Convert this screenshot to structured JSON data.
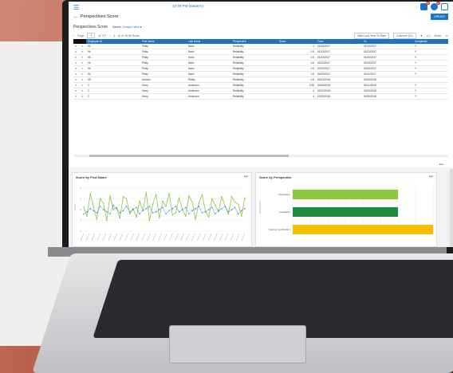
{
  "app": {
    "time": "12:48 PM (Eastern)",
    "notification_count": "99",
    "message_count": "10"
  },
  "page": {
    "title": "Perspectives Score",
    "create_label": "CREATE"
  },
  "view": {
    "title": "Perspectives Score",
    "saved_label": "Saved:",
    "saved_value": "Christy's View"
  },
  "pager": {
    "page_label": "Page",
    "page_value": "1",
    "of_label": "of 727",
    "rows_info": "1 - 15 of 10.9k Rows",
    "filter_chip": "Start Last Year To Date",
    "column_chip": "Columns (11)",
    "filter_count": "(1)",
    "mode_label": "Mode"
  },
  "table": {
    "columns": [
      "",
      "",
      "Employee ID",
      "First Name",
      "Last Name",
      "Perspective",
      "Score",
      "From",
      "To",
      "Completed"
    ],
    "rows": [
      [
        "",
        "",
        "94",
        "Philip",
        "Nash",
        "Reliability",
        "1",
        "01/08/2017",
        "01/15/2017",
        "Y"
      ],
      [
        "",
        "",
        "94",
        "Philip",
        "Nash",
        "Reliability",
        "0.5",
        "01/13/2017",
        "01/21/2017",
        "Y"
      ],
      [
        "",
        "",
        "94",
        "Philip",
        "Nash",
        "Reliability",
        "0.5",
        "01/23/2017",
        "01/30/2017",
        "Y"
      ],
      [
        "",
        "",
        "94",
        "Philip",
        "Nash",
        "Reliability",
        "0.5",
        "02/12/2017",
        "02/19/2017",
        "Y"
      ],
      [
        "",
        "",
        "94",
        "Philip",
        "Nash",
        "Reliability",
        "0.5",
        "02/20/2017",
        "02/04/2017",
        "Y"
      ],
      [
        "",
        "",
        "94",
        "Philip",
        "Nash",
        "Reliability",
        "0.5",
        "04/09/2017",
        "04/11/2017",
        "Y"
      ],
      [
        "",
        "",
        "39",
        "Ammon",
        "Ridley",
        "Reliability",
        "0.5",
        "04/23/2018",
        "04/30/2018",
        ""
      ],
      [
        "",
        "",
        "2",
        "Harry",
        "Anderson",
        "Reliability",
        "3.95",
        "03/25/2018",
        "03/11/2018",
        "Y"
      ],
      [
        "",
        "",
        "2",
        "Harry",
        "Anderson",
        "Reliability",
        "4",
        "03/12/2018",
        "03/20/2018",
        "Y"
      ],
      [
        "",
        "",
        "2",
        "Harry",
        "Anderson",
        "Reliability",
        "4",
        "03/25/2018",
        "04/30/2018",
        "Y"
      ]
    ]
  },
  "charts": {
    "left_title": "Score by First Name",
    "right_title": "Score by Perspective",
    "right_ylabel": "Perspective"
  },
  "chart_data": [
    {
      "type": "line",
      "title": "Score by First Name",
      "ylabel": "Score",
      "ylim": [
        0,
        4
      ],
      "series": [
        {
          "values": [
            2.2,
            1.4,
            3.5,
            2.2,
            1.1,
            3.0,
            2.6,
            1.0,
            3.3,
            2.0,
            2.2,
            1.2,
            3.2,
            3.0,
            1.6,
            2.1,
            1.3,
            2.8,
            1.9,
            3.6,
            1.0,
            2.5,
            3.4,
            1.2,
            2.8,
            2.3,
            3.5,
            1.5,
            1.7,
            3.1,
            2.0,
            1.4,
            3.3,
            2.7,
            1.1,
            2.6,
            3.4,
            1.9,
            1.3,
            3.0,
            2.4,
            1.8,
            3.2,
            2.3,
            1.6,
            3.2,
            2.7,
            2.5,
            1.4,
            3.1
          ]
        },
        {
          "values": [
            1.6,
            1.8,
            2.1,
            1.9,
            1.7,
            2.3,
            2.0,
            1.8,
            1.6,
            2.4,
            2.1,
            1.7,
            1.9,
            2.3,
            1.8,
            2.0,
            2.2,
            1.6,
            1.9,
            2.1,
            2.3,
            1.7,
            1.8,
            2.0,
            2.2,
            1.6,
            1.9,
            2.1,
            2.3,
            1.8,
            2.0,
            2.2,
            1.6,
            1.9,
            2.1,
            2.3,
            1.7,
            1.8,
            2.0,
            2.2,
            1.6,
            1.9,
            2.1,
            2.3,
            1.8,
            2.0,
            2.2,
            1.6,
            1.9,
            2.1
          ]
        }
      ]
    },
    {
      "type": "bar",
      "title": "Score by Perspective",
      "ylabel": "Perspective",
      "categories": [
        "Reputation",
        "Availability",
        "Training Certification"
      ],
      "values": [
        0.75,
        0.75,
        1.0
      ],
      "colors": [
        "#8dc63f",
        "#1e8a3c",
        "#f5c000"
      ]
    }
  ]
}
